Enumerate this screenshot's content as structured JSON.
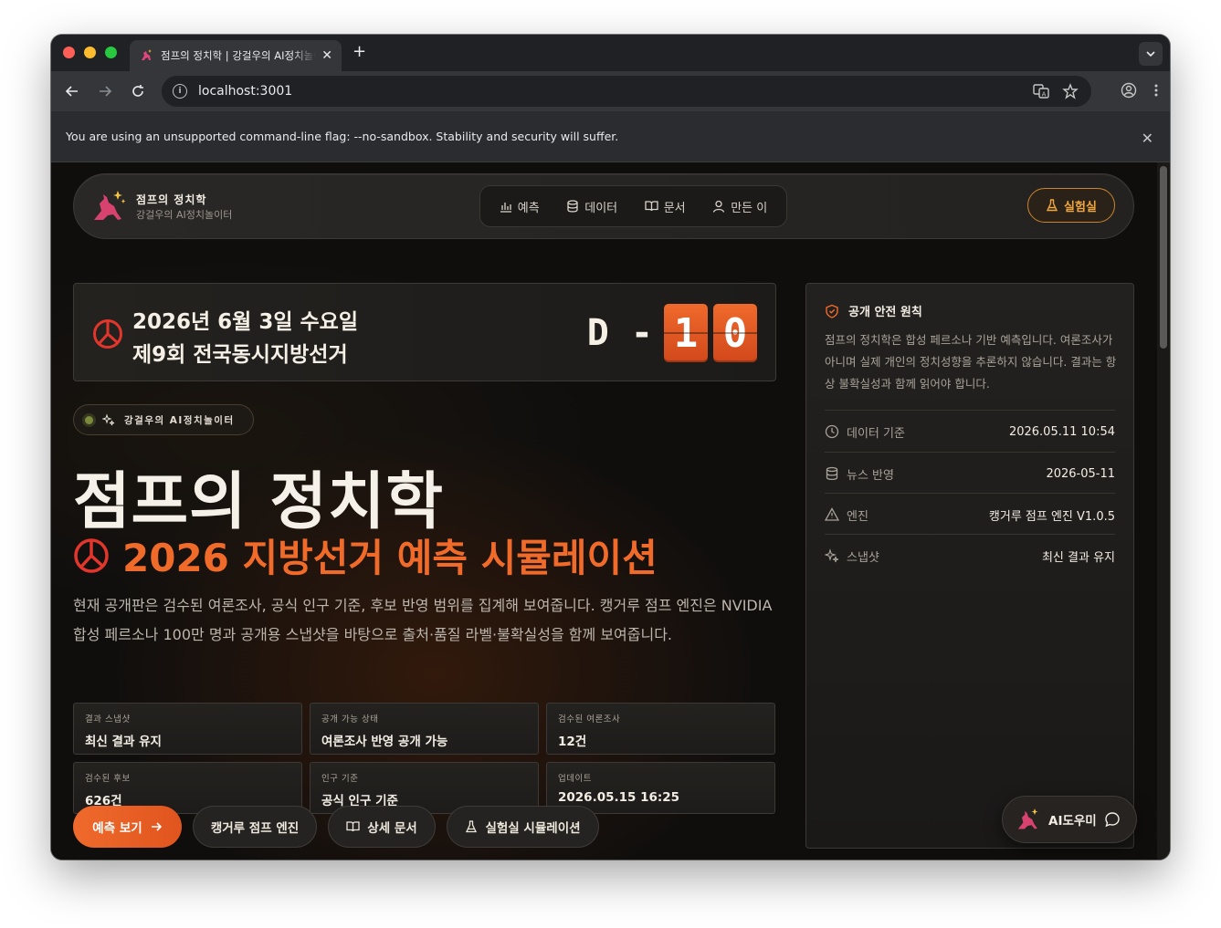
{
  "browser": {
    "tab_title": "점프의 정치학 | 강걸우의 AI정치놀이터",
    "url": "localhost:3001",
    "infobar_text": "You are using an unsupported command-line flag: --no-sandbox. Stability and security will suffer."
  },
  "header": {
    "brand_title": "점프의 정치학",
    "brand_subtitle": "강걸우의 AI정치놀이터",
    "nav": [
      {
        "label": "예측",
        "icon": "bar-chart-icon"
      },
      {
        "label": "데이터",
        "icon": "database-icon"
      },
      {
        "label": "문서",
        "icon": "book-icon"
      },
      {
        "label": "만든 이",
        "icon": "user-icon"
      }
    ],
    "lab_label": "실험실"
  },
  "election": {
    "date": "2026년 6월 3일 수요일",
    "name": "제9회 전국동시지방선거",
    "dday_label": "D -",
    "digits": [
      "1",
      "0"
    ]
  },
  "hero": {
    "chip": "강걸우의 AI정치놀이터",
    "title": "점프의 정치학",
    "subtitle": "2026 지방선거 예측 시뮬레이션",
    "description": "현재 공개판은 검수된 여론조사, 공식 인구 기준, 후보 반영 범위를 집계해 보여줍니다. 캥거루 점프 엔진은 NVIDIA 합성 페르소나 100만 명과 공개용 스냅샷을 바탕으로 출처·품질 라벨·불확실성을 함께 보여줍니다."
  },
  "stats": [
    {
      "label": "결과 스냅샷",
      "value": "최신 결과 유지"
    },
    {
      "label": "공개 가능 상태",
      "value": "여론조사 반영 공개 가능"
    },
    {
      "label": "검수된 여론조사",
      "value": "12건"
    },
    {
      "label": "검수된 후보",
      "value": "626건"
    },
    {
      "label": "인구 기준",
      "value": "공식 인구 기준"
    },
    {
      "label": "업데이트",
      "value": "2026.05.15 16:25"
    }
  ],
  "cta": {
    "primary": "예측 보기",
    "engine": "캥거루 점프 엔진",
    "docs": "상세 문서",
    "lab": "실험실 시뮬레이션"
  },
  "panel": {
    "title": "공개 안전 원칙",
    "body": "점프의 정치학은 합성 페르소나 기반 예측입니다. 여론조사가 아니며 실제 개인의 정치성향을 추론하지 않습니다. 결과는 항상 불확실성과 함께 읽어야 합니다.",
    "rows": [
      {
        "label": "데이터 기준",
        "value": "2026.05.11 10:54",
        "icon": "clock-icon"
      },
      {
        "label": "뉴스 반영",
        "value": "2026-05-11",
        "icon": "database-icon"
      },
      {
        "label": "엔진",
        "value": "캥거루 점프 엔진 V1.0.5",
        "icon": "warning-icon"
      },
      {
        "label": "스냅샷",
        "value": "최신 결과 유지",
        "icon": "sparkle-icon"
      }
    ]
  },
  "ai_helper": {
    "label": "AI도우미"
  },
  "colors": {
    "accent": "#ef6a2c",
    "lab_border": "#c9852c",
    "background": "#0f0e0d"
  }
}
